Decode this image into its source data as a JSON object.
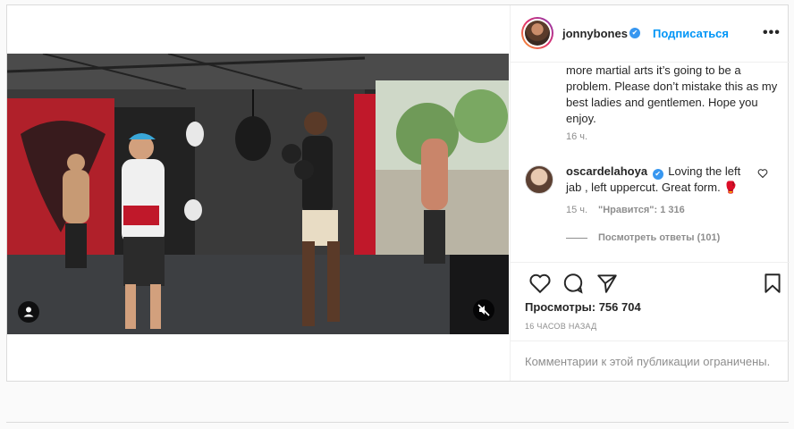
{
  "post": {
    "username": "jonnybones",
    "verified_mark": "✔",
    "follow_label": "Подписаться",
    "more_label": "•••",
    "caption": "more martial arts it’s going to be a problem. Please don’t mistake this as my best ladies and gentlemen. Hope you enjoy.",
    "caption_time": "16 ч.",
    "views_label": "Просмотры: 756 704",
    "date_label": "16 ЧАСОВ НАЗАД",
    "comments_restricted": "Комментарии к этой публикации ограничены."
  },
  "comment": {
    "username": "oscardelahoya",
    "verified_mark": "✔",
    "text": "Loving the left jab , left uppercut. Great form.",
    "emoji": "🥊",
    "time": "15 ч.",
    "likes": "\"Нравится\": 1 316",
    "replies_label": "Посмотреть ответы (101)"
  },
  "icons": {
    "heart": "heart-icon",
    "comment": "comment-icon",
    "share": "share-icon",
    "bookmark": "bookmark-icon",
    "user_tag": "user-tag-icon",
    "mute": "mute-icon",
    "more": "more-options-icon"
  },
  "colors": {
    "accent": "#0095f6",
    "verified": "#3897f0",
    "muted_text": "#8e8e8e",
    "border": "#dbdbdb"
  }
}
